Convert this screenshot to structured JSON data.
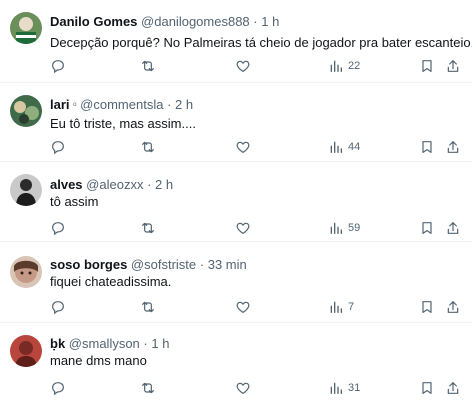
{
  "replies": [
    {
      "name": "Danilo Gomes",
      "handle": "@danilogomes888",
      "separator": "·",
      "time": "1 h",
      "text": "Decepção porquê? No Palmeiras tá cheio de jogador pra bater escanteio.",
      "views": "22",
      "badge": ""
    },
    {
      "name": "lari",
      "badge": "ᵒ",
      "handle": "@commentsla",
      "separator": "·",
      "time": "2 h",
      "text": "Eu tô triste, mas assim....",
      "views": "44"
    },
    {
      "name": "alves",
      "handle": "@aleozxx",
      "separator": "·",
      "time": "2 h",
      "text": "tô assim",
      "views": "59",
      "badge": ""
    },
    {
      "name": "soso borges",
      "handle": "@sofstriste",
      "separator": "·",
      "time": "33 min",
      "text": "fiquei chateadissima.",
      "views": "7",
      "badge": ""
    },
    {
      "name": "ḅk",
      "handle": "@smallyson",
      "separator": "·",
      "time": "1 h",
      "text": "mane dms mano",
      "views": "31",
      "badge": ""
    }
  ],
  "icons": {
    "reply": "reply-icon",
    "repost": "repost-icon",
    "like": "like-icon",
    "views": "views-icon",
    "bookmark": "bookmark-icon",
    "share": "share-icon"
  },
  "colors": {
    "text": "#0f1419",
    "secondary": "#536471",
    "divider": "#eff3f4"
  }
}
